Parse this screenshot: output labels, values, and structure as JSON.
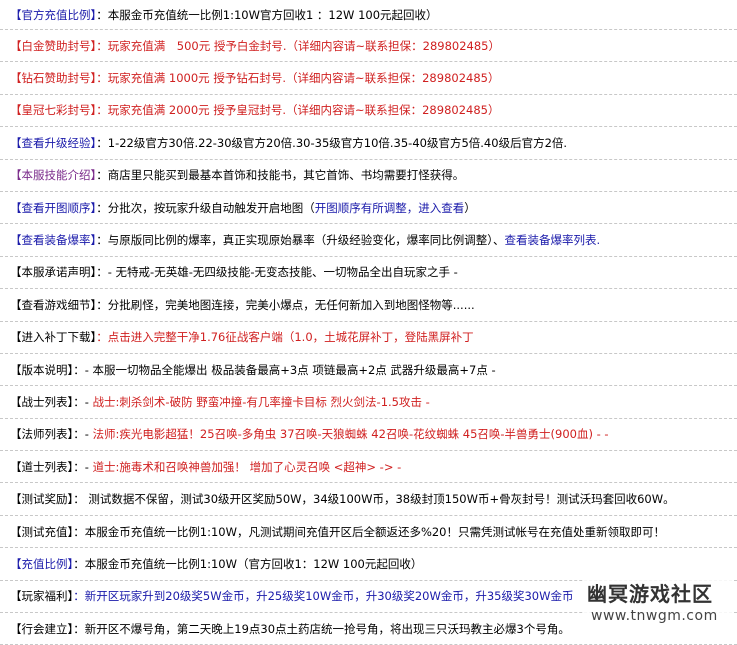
{
  "rows": [
    {
      "tag": "【官方充值比例】",
      "tag_color": "#1a1aaa",
      "segments": [
        {
          "text": "：本服金币充值统一比例1:10W官方回收1 ：12W 100元起回收）",
          "color": "#000000"
        }
      ]
    },
    {
      "tag": "【白金赞助封号】",
      "tag_color": "#d02020",
      "segments": [
        {
          "text": "：玩家充值满　500元 授予白金封号.（详细内容请~联系担保：289802485）",
          "color": "#d02020"
        }
      ]
    },
    {
      "tag": "【钻石赞助封号】",
      "tag_color": "#d02020",
      "segments": [
        {
          "text": "：玩家充值满 1000元 授予钻石封号.（详细内容请~联系担保：289802485）",
          "color": "#d02020"
        }
      ]
    },
    {
      "tag": "【皇冠七彩封号】",
      "tag_color": "#d02020",
      "segments": [
        {
          "text": "：玩家充值满 2000元 授予皇冠封号.（详细内容请~联系担保：289802485）",
          "color": "#d02020"
        }
      ]
    },
    {
      "tag": "【查看升级经验】",
      "tag_color": "#1a1aaa",
      "segments": [
        {
          "text": "：1-22级官方30倍.22-30级官方20倍.30-35级官方10倍.35-40级官方5倍.40级后官方2倍.",
          "color": "#000000"
        }
      ]
    },
    {
      "tag": "【本服技能介绍】",
      "tag_color": "#7a2a8a",
      "segments": [
        {
          "text": "：商店里只能买到最基本首饰和技能书，其它首饰、书均需要打怪获得。",
          "color": "#000000"
        }
      ]
    },
    {
      "tag": "【查看开图顺序】",
      "tag_color": "#1a1aaa",
      "segments": [
        {
          "text": "：分批次，按玩家升级自动触发开启地图（",
          "color": "#000000"
        },
        {
          "text": "开图顺序有所调整，进入查看",
          "color": "#1a1aaa"
        },
        {
          "text": "）",
          "color": "#000000"
        }
      ]
    },
    {
      "tag": "【查看装备爆率】",
      "tag_color": "#1a1aaa",
      "segments": [
        {
          "text": "：与原版同比例的爆率，真正实现原始暴率（升级经验变化，爆率同比例调整）、",
          "color": "#000000"
        },
        {
          "text": "查看装备爆率列表.",
          "color": "#1a1aaa"
        }
      ]
    },
    {
      "tag": "【本服承诺声明】",
      "tag_color": "#000000",
      "segments": [
        {
          "text": "：- 无特戒-无英雄-无四级技能-无变态技能、一切物品全出自玩家之手 -",
          "color": "#000000"
        }
      ]
    },
    {
      "tag": "【查看游戏细节】",
      "tag_color": "#000000",
      "segments": [
        {
          "text": "：分批刷怪，完美地图连接，完美小爆点，无任何新加入到地图怪物等......",
          "color": "#000000"
        }
      ]
    },
    {
      "tag": "【进入补丁下载】",
      "tag_color": "#000000",
      "segments": [
        {
          "text": "：点击进入完整干净1.76征战客户端（1.0，土城花屏补丁，登陆黑屏补丁",
          "color": "#d02020"
        }
      ]
    },
    {
      "tag": "【版本说明】",
      "tag_color": "#000000",
      "segments": [
        {
          "text": "：- 本服一切物品全能爆出 极品装备最高+3点 项链最高+2点 武器升级最高+7点 -",
          "color": "#000000"
        }
      ]
    },
    {
      "tag": "【战士列表】",
      "tag_color": "#000000",
      "segments": [
        {
          "text": "：- ",
          "color": "#000000"
        },
        {
          "text": "战士:刺杀剑术-破防 野蛮冲撞-有几率撞卡目标 烈火剑法-1.5攻击 -",
          "color": "#d02020"
        }
      ]
    },
    {
      "tag": "【法师列表】",
      "tag_color": "#000000",
      "segments": [
        {
          "text": "：- ",
          "color": "#000000"
        },
        {
          "text": "法师:疾光电影超猛！25召唤-多角虫 37召唤-天狼蜘蛛 42召唤-花纹蜘蛛 45召唤-半兽勇士(900血) - -",
          "color": "#d02020"
        }
      ]
    },
    {
      "tag": "【道士列表】",
      "tag_color": "#000000",
      "segments": [
        {
          "text": "：- ",
          "color": "#000000"
        },
        {
          "text": "道士:施毒术和召唤神兽加强！ 增加了心灵召唤 <超神> -> -",
          "color": "#d02020"
        }
      ]
    },
    {
      "tag": "【测试奖励】",
      "tag_color": "#000000",
      "segments": [
        {
          "text": "： 测试数据不保留，测试30级开区奖励50W，34级100W币，38级封顶150W币+骨灰封号！测试沃玛套回收60W。",
          "color": "#000000"
        }
      ]
    },
    {
      "tag": "【测试充值】",
      "tag_color": "#000000",
      "segments": [
        {
          "text": "：本服金币充值统一比例1:10W，凡测试期间充值开区后全额返还多%20！只需凭测试帐号在充值处重新领取即可！",
          "color": "#000000"
        }
      ]
    },
    {
      "tag": "【充值比例】",
      "tag_color": "#1a1aaa",
      "segments": [
        {
          "text": "：本服金币充值统一比例1:10W（官方回收1：12W 100元起回收）",
          "color": "#000000"
        }
      ]
    },
    {
      "tag": "【玩家福利】",
      "tag_color": "#000000",
      "segments": [
        {
          "text": "：新开区玩家升到20级奖5W金币，升25级奖10W金币，升30级奖20W金币，升35级奖30W金币",
          "color": "#1a1aaa"
        }
      ]
    },
    {
      "tag": "【行会建立】",
      "tag_color": "#000000",
      "segments": [
        {
          "text": "：新开区不爆号角，第二天晚上19点30点土药店统一抢号角，将出现三只沃玛教主必爆3个号角。",
          "color": "#000000"
        }
      ]
    }
  ],
  "watermark": {
    "title": "幽冥游戏社区",
    "url": "www.tnwgm.com"
  }
}
